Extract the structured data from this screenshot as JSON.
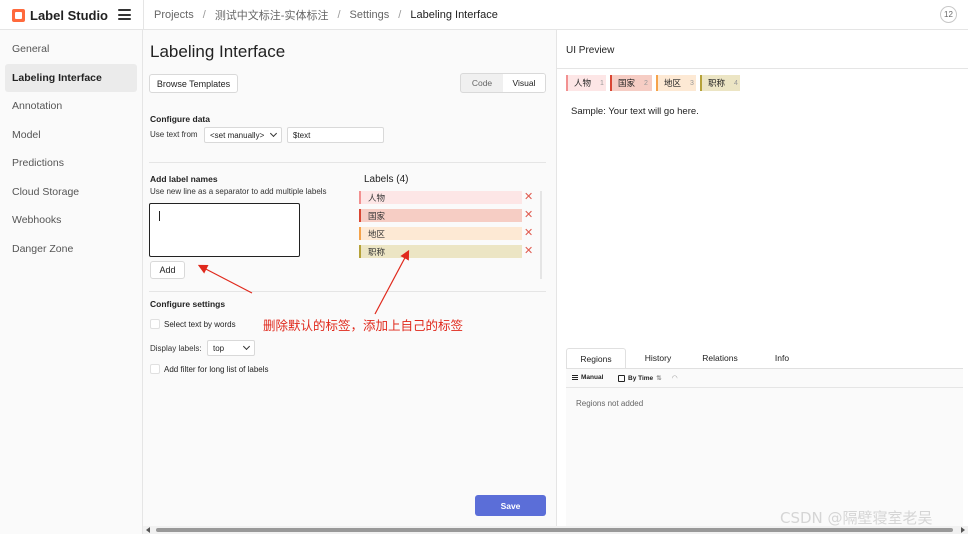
{
  "app": {
    "name": "Label Studio",
    "user_initials": "12"
  },
  "breadcrumbs": [
    "Projects",
    "测试中文标注-实体标注",
    "Settings",
    "Labeling Interface"
  ],
  "sidebar": {
    "items": [
      {
        "label": "General"
      },
      {
        "label": "Labeling Interface",
        "active": true
      },
      {
        "label": "Annotation"
      },
      {
        "label": "Model"
      },
      {
        "label": "Predictions"
      },
      {
        "label": "Cloud Storage"
      },
      {
        "label": "Webhooks"
      },
      {
        "label": "Danger Zone"
      }
    ]
  },
  "main": {
    "title": "Labeling Interface",
    "browse_templates": "Browse Templates",
    "view_toggle": {
      "code": "Code",
      "visual": "Visual",
      "selected": "Visual"
    },
    "configure_data": {
      "heading": "Configure data",
      "use_text_from_label": "Use text from",
      "source_select": "<set manually>",
      "value": "$text"
    },
    "add_labels": {
      "heading": "Add label names",
      "hint": "Use new line as a separator to add multiple labels",
      "textarea_value": "",
      "add_button": "Add"
    },
    "labels": {
      "heading": "Labels (4)",
      "items": [
        {
          "name": "人物",
          "color": "#f29191",
          "bg": "#fde6e6"
        },
        {
          "name": "国家",
          "color": "#d94633",
          "bg": "#f6cdc4"
        },
        {
          "name": "地区",
          "color": "#f5a34b",
          "bg": "#fde9d4"
        },
        {
          "name": "职称",
          "color": "#b5a23a",
          "bg": "#ece5c4"
        }
      ]
    },
    "settings": {
      "heading": "Configure settings",
      "select_by_words": "Select text by words",
      "display_labels_label": "Display labels:",
      "display_labels_value": "top",
      "add_filter": "Add filter for long list of labels"
    },
    "save": "Save"
  },
  "annotation_text": "删除默认的标签，添加上自己的标签",
  "preview": {
    "title": "UI Preview",
    "chips": [
      {
        "name": "人物",
        "hotkey": "1",
        "color": "#f29191",
        "bg": "#fde6e6"
      },
      {
        "name": "国家",
        "hotkey": "2",
        "color": "#d94633",
        "bg": "#f6cdc4"
      },
      {
        "name": "地区",
        "hotkey": "3",
        "color": "#f5a34b",
        "bg": "#fde9d4"
      },
      {
        "name": "职称",
        "hotkey": "4",
        "color": "#b5a23a",
        "bg": "#ece5c4"
      }
    ],
    "sample_text": "Sample: Your text will go here.",
    "tabs": [
      "Regions",
      "History",
      "Relations",
      "Info"
    ],
    "active_tab": "Regions",
    "toolbar": {
      "manual": "Manual",
      "by_time": "By Time"
    },
    "empty_message": "Regions not added"
  },
  "watermark": "CSDN @隔壁寝室老吴"
}
